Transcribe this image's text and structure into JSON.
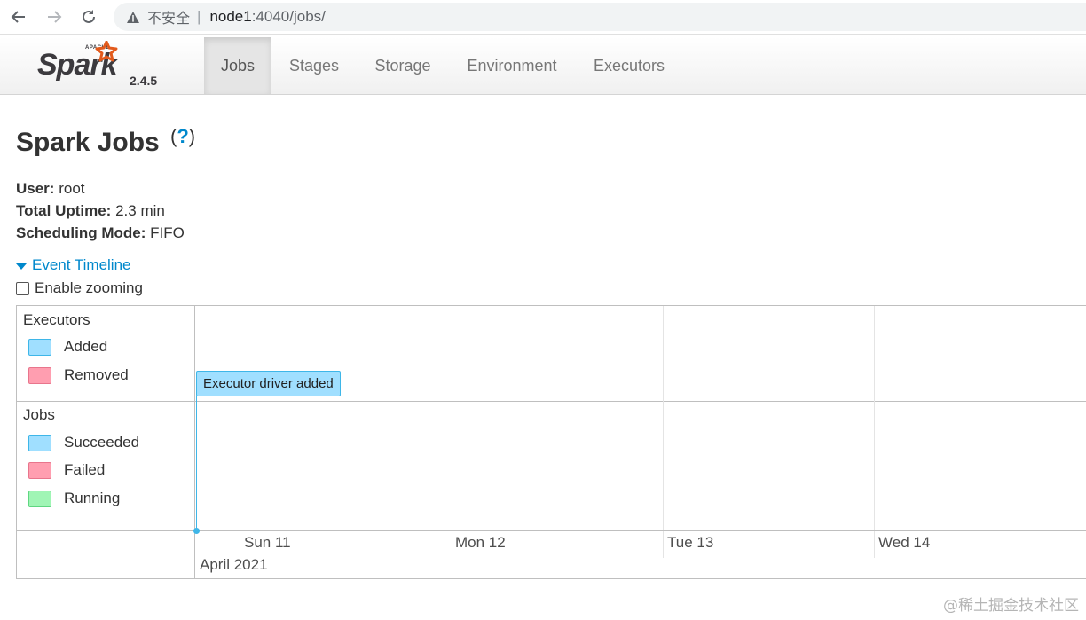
{
  "browser": {
    "security_label": "不安全",
    "separator": "|",
    "url_host": "node1",
    "url_path": ":4040/jobs/"
  },
  "navbar": {
    "logo_small": "APACHE",
    "logo_word": "Spark",
    "version": "2.4.5",
    "tabs": [
      {
        "label": "Jobs",
        "active": true
      },
      {
        "label": "Stages"
      },
      {
        "label": "Storage"
      },
      {
        "label": "Environment"
      },
      {
        "label": "Executors"
      }
    ]
  },
  "page": {
    "title": "Spark Jobs",
    "help_open": "(",
    "help_mark": "?",
    "help_close": ")",
    "info": [
      {
        "label": "User:",
        "value": "root"
      },
      {
        "label": "Total Uptime:",
        "value": "2.3 min"
      },
      {
        "label": "Scheduling Mode:",
        "value": "FIFO"
      }
    ],
    "timeline_toggle": "Event Timeline",
    "zoom_label": "Enable zooming"
  },
  "timeline": {
    "executors_group": {
      "title": "Executors",
      "legend": [
        {
          "label": "Added",
          "color": "#a0dfff"
        },
        {
          "label": "Removed",
          "color": "#ff9eb0"
        }
      ]
    },
    "jobs_group": {
      "title": "Jobs",
      "legend": [
        {
          "label": "Succeeded",
          "color": "#a0dfff"
        },
        {
          "label": "Failed",
          "color": "#ff9eb0"
        },
        {
          "label": "Running",
          "color": "#a0f5b5"
        }
      ]
    },
    "event_label": "Executor driver added",
    "axis_minor": [
      "Sun 11",
      "Mon 12",
      "Tue 13",
      "Wed 14"
    ],
    "axis_major": "April 2021"
  },
  "watermark": "@稀土掘金技术社区"
}
